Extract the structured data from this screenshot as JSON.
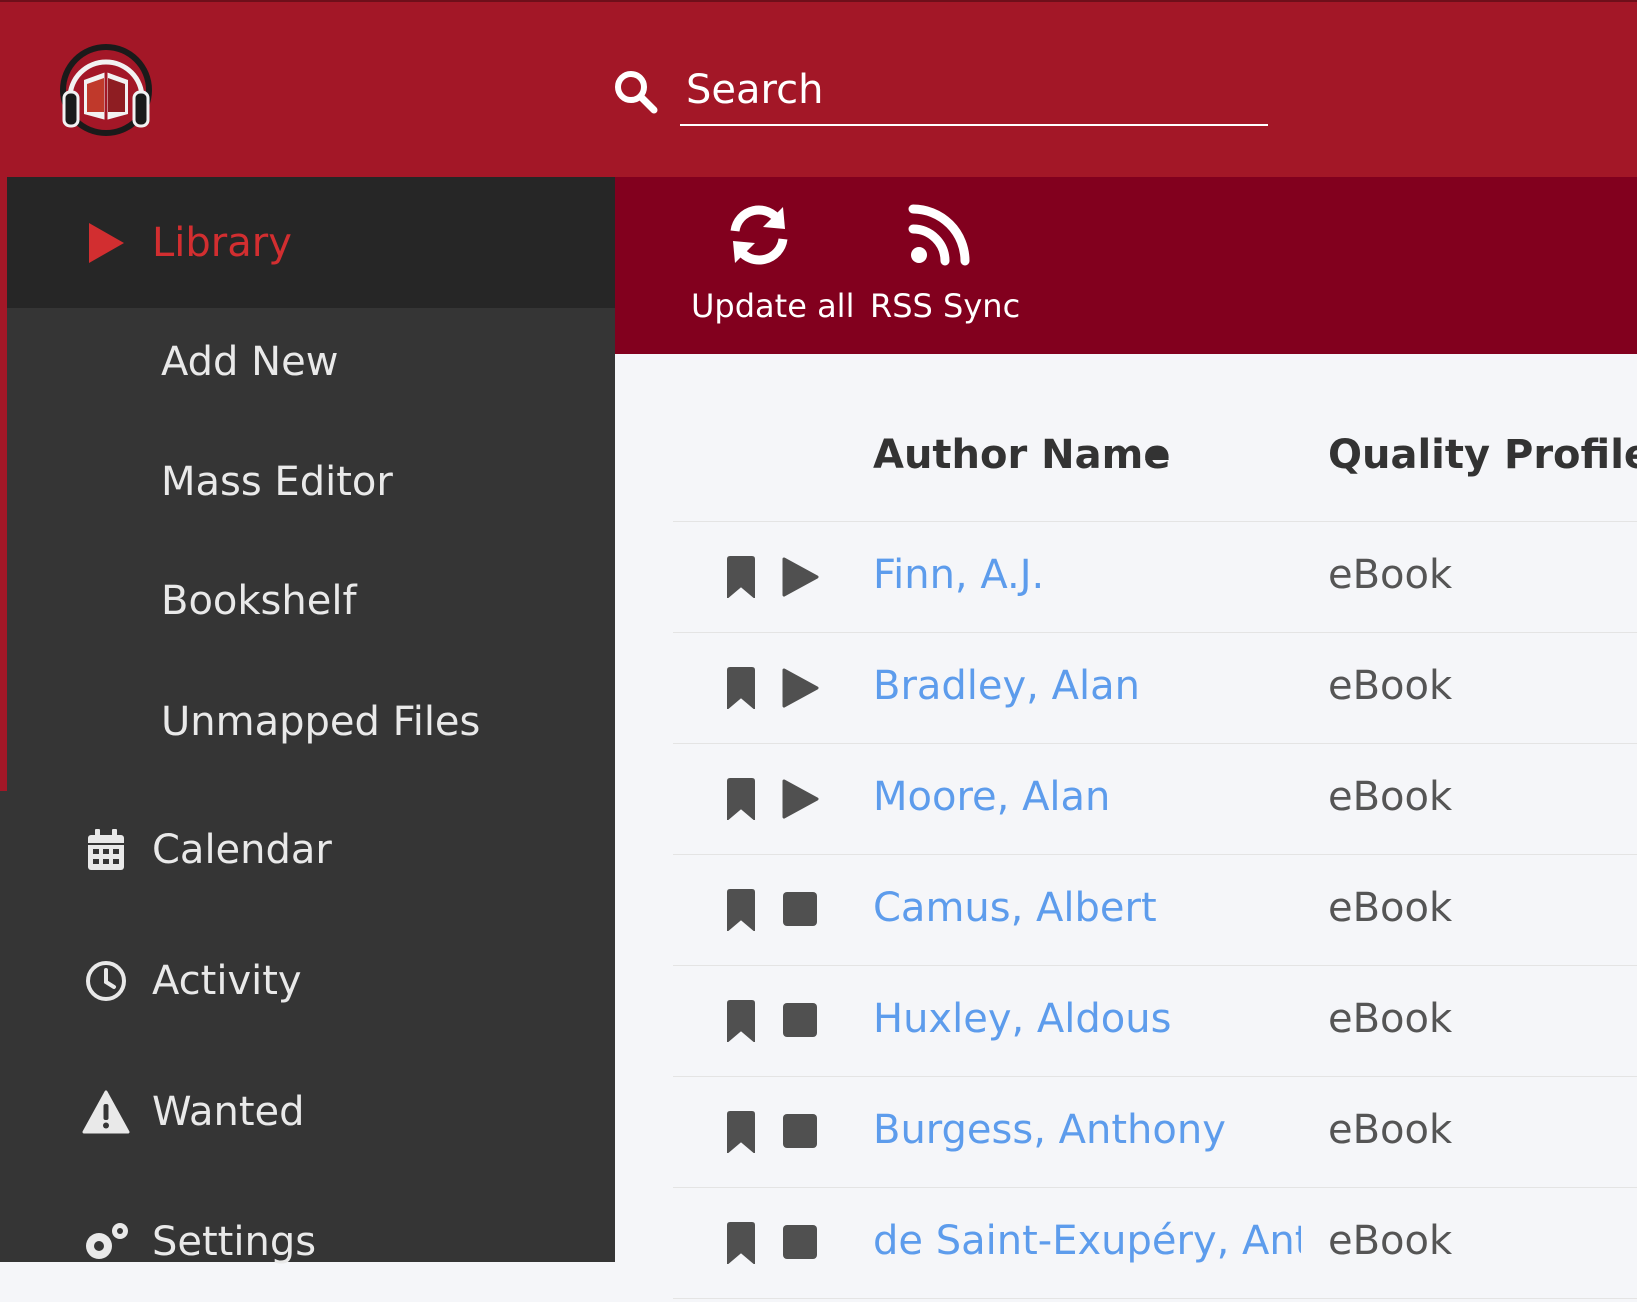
{
  "header": {
    "logo": "readarr-logo-icon",
    "search": {
      "placeholder": "Search",
      "value": ""
    },
    "color": "#a31727"
  },
  "sidebar": {
    "items": [
      {
        "label": "Library",
        "icon": "play-icon",
        "active": true
      },
      {
        "label": "Add New",
        "sub": true
      },
      {
        "label": "Mass Editor",
        "sub": true
      },
      {
        "label": "Bookshelf",
        "sub": true
      },
      {
        "label": "Unmapped Files",
        "sub": true
      },
      {
        "label": "Calendar",
        "icon": "calendar-icon"
      },
      {
        "label": "Activity",
        "icon": "clock-icon"
      },
      {
        "label": "Wanted",
        "icon": "warning-icon"
      },
      {
        "label": "Settings",
        "icon": "gears-icon"
      }
    ],
    "active_color": "#d22e30"
  },
  "toolbar": {
    "update_all_label": "Update all",
    "rss_sync_label": "RSS Sync",
    "color": "#82001e"
  },
  "table": {
    "columns": {
      "author_name": "Author Name",
      "quality_profile": "Quality Profile"
    },
    "sort": {
      "column": "author_name",
      "direction": "ascending"
    },
    "rows": [
      {
        "author": "Finn, A.J.",
        "quality": "eBook",
        "monitored": true,
        "status": "continuing"
      },
      {
        "author": "Bradley, Alan",
        "quality": "eBook",
        "monitored": true,
        "status": "continuing"
      },
      {
        "author": "Moore, Alan",
        "quality": "eBook",
        "monitored": true,
        "status": "continuing"
      },
      {
        "author": "Camus, Albert",
        "quality": "eBook",
        "monitored": true,
        "status": "ended"
      },
      {
        "author": "Huxley, Aldous",
        "quality": "eBook",
        "monitored": true,
        "status": "ended"
      },
      {
        "author": "Burgess, Anthony",
        "quality": "eBook",
        "monitored": true,
        "status": "ended"
      },
      {
        "author": "de Saint-Exupéry, Antoir",
        "quality": "eBook",
        "monitored": true,
        "status": "ended"
      }
    ],
    "link_color": "#5d9cec"
  }
}
